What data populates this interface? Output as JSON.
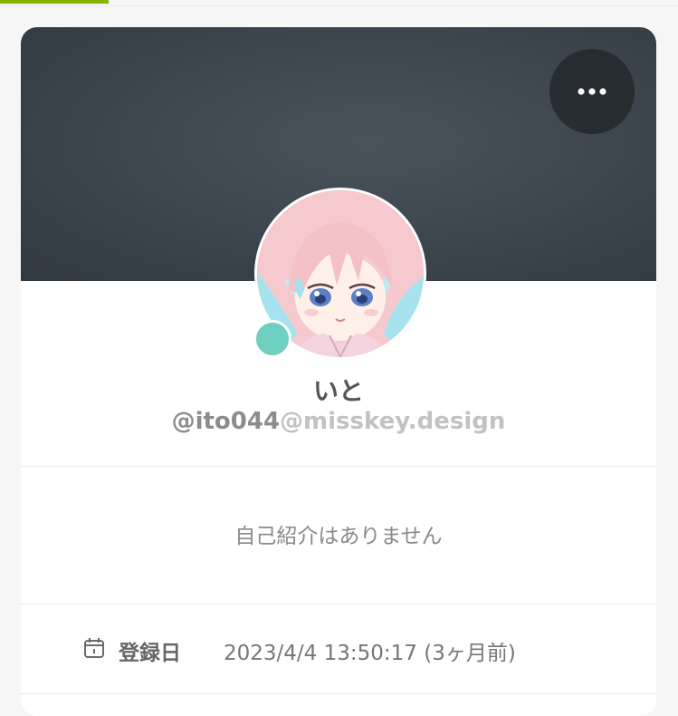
{
  "colors": {
    "accent_progress": "#86b300",
    "banner": "#3f4850",
    "online_indicator": "#6fcfc0"
  },
  "banner": {
    "menu_icon": "more-horizontal-icon"
  },
  "profile": {
    "display_name": "いと",
    "username": "@ito044",
    "host": "@misskey.design",
    "online": true
  },
  "bio": {
    "text": "自己紹介はありません"
  },
  "fields": [
    {
      "icon": "calendar-icon",
      "label": "登録日",
      "value": "2023/4/4 13:50:17 (3ヶ月前)"
    }
  ]
}
